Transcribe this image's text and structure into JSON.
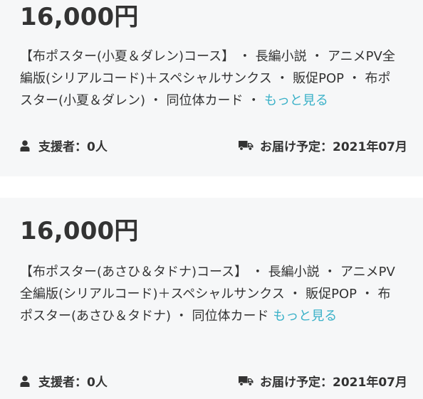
{
  "rewards": [
    {
      "price": "16,000円",
      "description": "【布ポスター(小夏＆ダレン)コース】 ・ 長編小説 ・ アニメPV全編版(シリアルコード)＋スペシャルサンクス ・ 販促POP ・ 布ポスター(小夏＆ダレン) ・ 同位体カード ・ ",
      "more_link": "もっと見る",
      "supporters_label": "支援者：",
      "supporters_value": "0人",
      "delivery_label": "お届け予定：",
      "delivery_value": "2021年07月"
    },
    {
      "price": "16,000円",
      "description": "【布ポスター(あさひ＆タドナ)コース】 ・ 長編小説 ・ アニメPV全編版(シリアルコード)＋スペシャルサンクス ・ 販促POP ・ 布ポスター(あさひ＆タドナ) ・ 同位体カード ",
      "more_link": "もっと見る",
      "supporters_label": "支援者：",
      "supporters_value": "0人",
      "delivery_label": "お届け予定：",
      "delivery_value": "2021年07月"
    }
  ],
  "icons": {
    "user": "user-icon",
    "truck": "truck-icon"
  },
  "colors": {
    "card_background": "#f6f7f8",
    "text": "#333333",
    "link": "#3ab1c8"
  }
}
